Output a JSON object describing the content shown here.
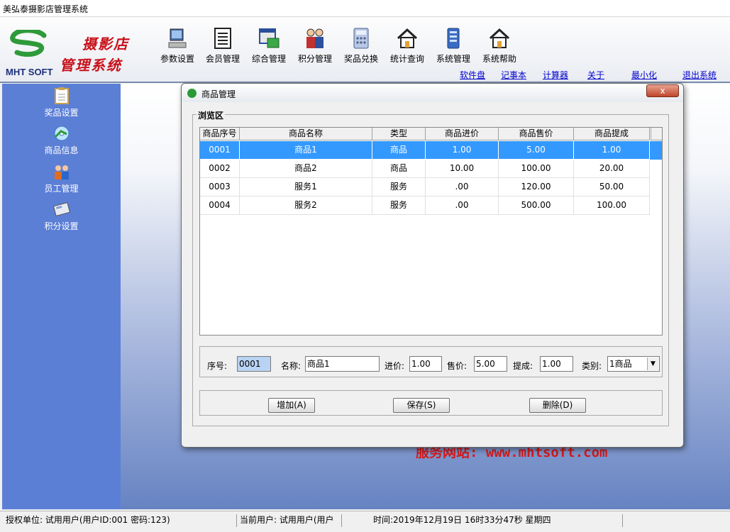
{
  "window": {
    "title": "美弘泰摄影店管理系统"
  },
  "logo": {
    "brand": "MHT SOFT",
    "line1": "摄影店",
    "line2": "管理系统"
  },
  "toolbar": [
    {
      "label": "参数设置",
      "icon": "computer-icon"
    },
    {
      "label": "会员管理",
      "icon": "document-list-icon"
    },
    {
      "label": "综合管理",
      "icon": "window-folder-icon"
    },
    {
      "label": "积分管理",
      "icon": "people-icon"
    },
    {
      "label": "奖品兑换",
      "icon": "calculator-icon"
    },
    {
      "label": "统计查询",
      "icon": "house-icon"
    },
    {
      "label": "系统管理",
      "icon": "server-icon"
    },
    {
      "label": "系统帮助",
      "icon": "house-icon"
    }
  ],
  "toplinks": [
    "软件盘",
    "记事本",
    "计算器",
    "关于",
    "最小化",
    "退出系统"
  ],
  "sidebar": [
    {
      "label": "奖品设置",
      "icon": "clipboard-icon"
    },
    {
      "label": "商品信息",
      "icon": "disc-icon"
    },
    {
      "label": "员工管理",
      "icon": "staff-icon"
    },
    {
      "label": "积分设置",
      "icon": "calculator-icon"
    }
  ],
  "website": "服务网站: www.mhtsoft.com",
  "dialog": {
    "title": "商品管理",
    "close_label": "x",
    "browse_legend": "浏览区",
    "columns": [
      "商品序号",
      "商品名称",
      "类型",
      "商品进价",
      "商品售价",
      "商品提成"
    ],
    "rows": [
      [
        "0001",
        "商品1",
        "商品",
        "1.00",
        "5.00",
        "1.00"
      ],
      [
        "0002",
        "商品2",
        "商品",
        "10.00",
        "100.00",
        "20.00"
      ],
      [
        "0003",
        "服务1",
        "服务",
        ".00",
        "120.00",
        "50.00"
      ],
      [
        "0004",
        "服务2",
        "服务",
        ".00",
        "500.00",
        "100.00"
      ]
    ],
    "form": {
      "id_label": "序号:",
      "id_value": "0001",
      "name_label": "名称:",
      "name_value": "商品1",
      "cost_label": "进价:",
      "cost_value": "1.00",
      "price_label": "售价:",
      "price_value": "5.00",
      "commission_label": "提成:",
      "commission_value": "1.00",
      "category_label": "类别:",
      "category_value": "1商品"
    },
    "buttons": {
      "add": "增加(A)",
      "save": "保存(S)",
      "delete": "删除(D)"
    }
  },
  "statusbar": {
    "org": "授权单位: 试用用户(用户ID:001 密码:123)",
    "user": "当前用户: 试用用户(用户",
    "time": "时间:2019年12月19日 16时33分47秒 星期四"
  },
  "colors": {
    "sidebar": "#5c7fd6",
    "selection": "#3399ff",
    "website_text": "#d31b1b",
    "brand_red": "#c8101a"
  }
}
